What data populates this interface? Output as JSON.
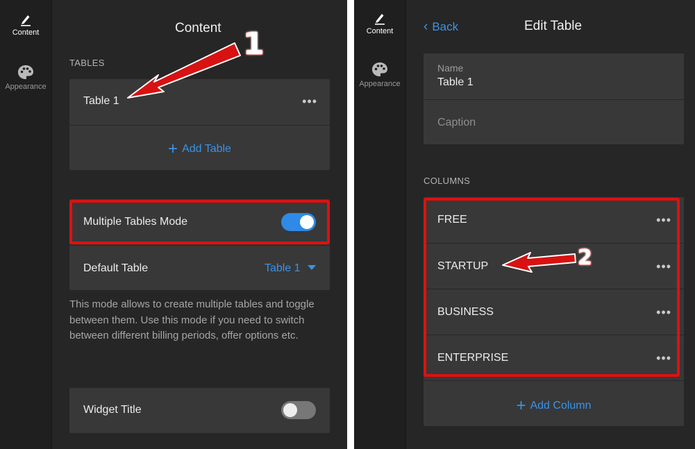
{
  "rail": {
    "content_label": "Content",
    "appearance_label": "Appearance",
    "icons": {
      "content": "pencil-icon",
      "appearance": "palette-icon"
    }
  },
  "left_panel": {
    "title": "Content",
    "tables_section": "TABLES",
    "table_item": "Table 1",
    "table_item_menu": "•••",
    "add_table": "Add Table",
    "multiple_tables_mode": {
      "label": "Multiple Tables Mode",
      "enabled": true
    },
    "default_table": {
      "label": "Default Table",
      "value": "Table 1"
    },
    "description": "This mode allows to create multiple tables and toggle between them. Use this mode if you need to switch between different billing periods, offer options etc.",
    "widget_title": {
      "label": "Widget Title",
      "enabled": false
    }
  },
  "right_panel": {
    "back_label": "Back",
    "title": "Edit Table",
    "name_label": "Name",
    "name_value": "Table 1",
    "caption_placeholder": "Caption",
    "columns_section": "COLUMNS",
    "columns": [
      {
        "label": "FREE",
        "menu": "•••"
      },
      {
        "label": "STARTUP",
        "menu": "•••"
      },
      {
        "label": "BUSINESS",
        "menu": "•••"
      },
      {
        "label": "ENTERPRISE",
        "menu": "•••"
      }
    ],
    "add_column": "Add Column"
  },
  "annotations": {
    "step1": "1",
    "step2": "2"
  },
  "colors": {
    "accent": "#2e8ae6",
    "link": "#3a93e8",
    "highlight": "#e01010",
    "panel_bg": "#262626",
    "card_bg": "#383838"
  }
}
